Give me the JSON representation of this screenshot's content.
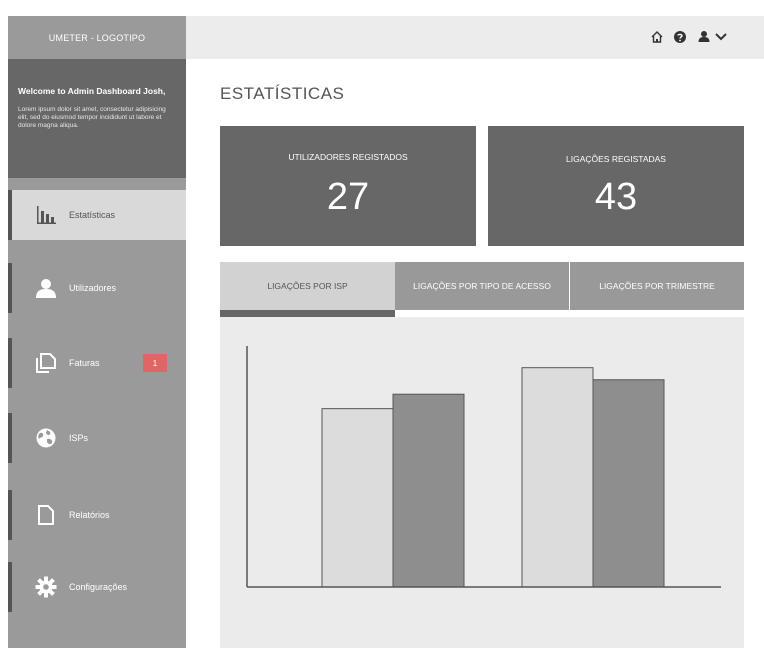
{
  "sidebar": {
    "logo": "UMETER - LOGOTIPO",
    "welcome_title": "Welcome to Admin Dashboard Josh,",
    "welcome_text": "Lorem ipsum dolor sit amet, consectetur adipisicing elit, sed do eiusmod tempor incididunt ut labore et dolore magna aliqua.",
    "items": [
      {
        "label": "Estatísticas",
        "icon": "bar-chart-icon",
        "active": true
      },
      {
        "label": "Utilizadores",
        "icon": "user-icon"
      },
      {
        "label": "Faturas",
        "icon": "documents-icon",
        "badge": "1"
      },
      {
        "label": "ISPs",
        "icon": "globe-icon"
      },
      {
        "label": "Relatórios",
        "icon": "document-icon"
      },
      {
        "label": "Configurações",
        "icon": "gear-icon"
      }
    ]
  },
  "topbar": {
    "icons": [
      "home-icon",
      "help-icon",
      "user-menu-icon"
    ]
  },
  "main": {
    "title": "ESTATÍSTICAS",
    "cards": [
      {
        "label": "UTILIZADORES REGISTADOS",
        "value": "27"
      },
      {
        "label": "LIGAÇÕES REGISTADAS",
        "value": "43"
      }
    ],
    "tabs": [
      {
        "label": "LIGAÇÕES POR ISP",
        "active": true
      },
      {
        "label": "LIGAÇÕES POR TIPO DE ACESSO"
      },
      {
        "label": "LIGAÇÕES POR TRIMESTRE"
      }
    ]
  },
  "colors": {
    "sidebar": "#9a9a9a",
    "dark": "#676767",
    "badge": "#e06666",
    "panel": "#ebebeb"
  },
  "chart_data": {
    "type": "bar",
    "categories": [
      "",
      ""
    ],
    "series": [
      {
        "values": [
          0.74,
          0.91
        ]
      },
      {
        "values": [
          0.8,
          0.86
        ]
      }
    ],
    "ylim": [
      0,
      1
    ],
    "grid": false,
    "series_colors": [
      "#dcdcdc",
      "#8e8e8e"
    ]
  }
}
